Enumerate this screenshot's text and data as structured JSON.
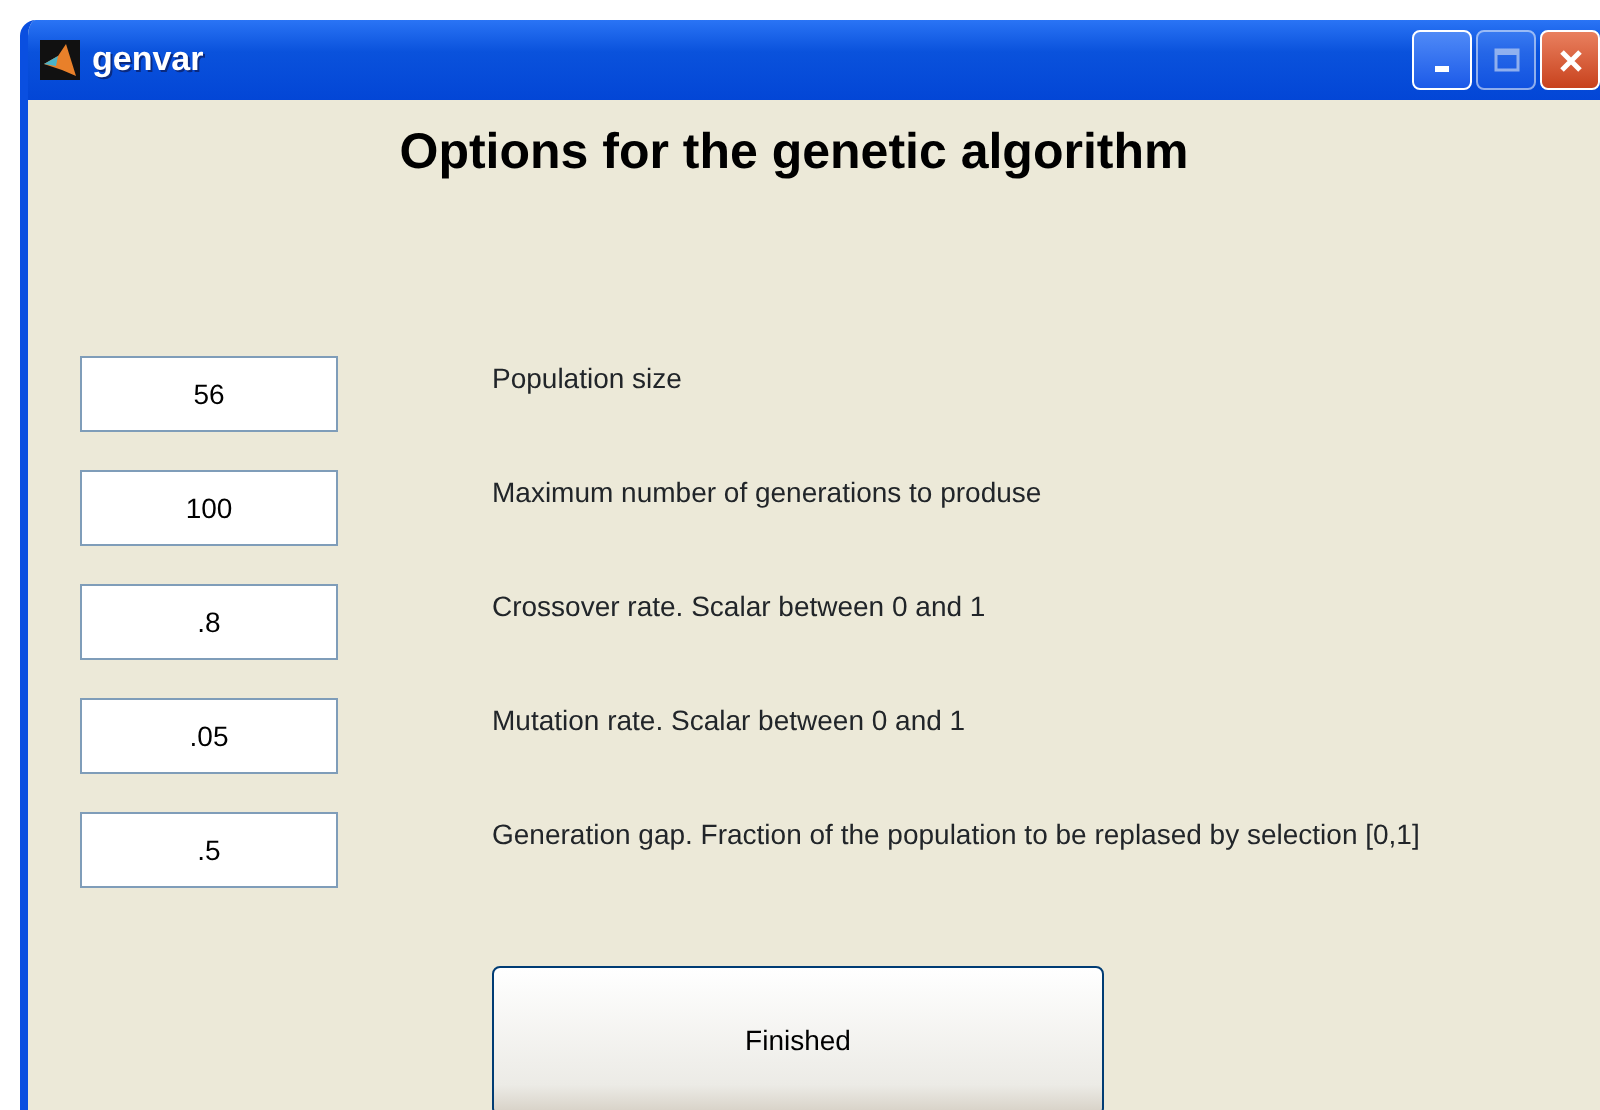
{
  "window": {
    "title": "genvar",
    "controls": [
      {
        "kind": "minimize",
        "disabled": false
      },
      {
        "kind": "maximize",
        "disabled": true
      },
      {
        "kind": "close",
        "disabled": false
      }
    ]
  },
  "heading": "Options for the genetic algorithm",
  "options": [
    {
      "value": "56",
      "label": "Population size"
    },
    {
      "value": "100",
      "label": "Maximum number of generations to produse"
    },
    {
      "value": ".8",
      "label": "Crossover rate. Scalar between 0 and 1"
    },
    {
      "value": ".05",
      "label": "Mutation rate. Scalar between 0 and 1"
    },
    {
      "value": ".5",
      "label": "Generation gap. Fraction of the population to be replased by selection [0,1]"
    }
  ],
  "button": "Finished"
}
